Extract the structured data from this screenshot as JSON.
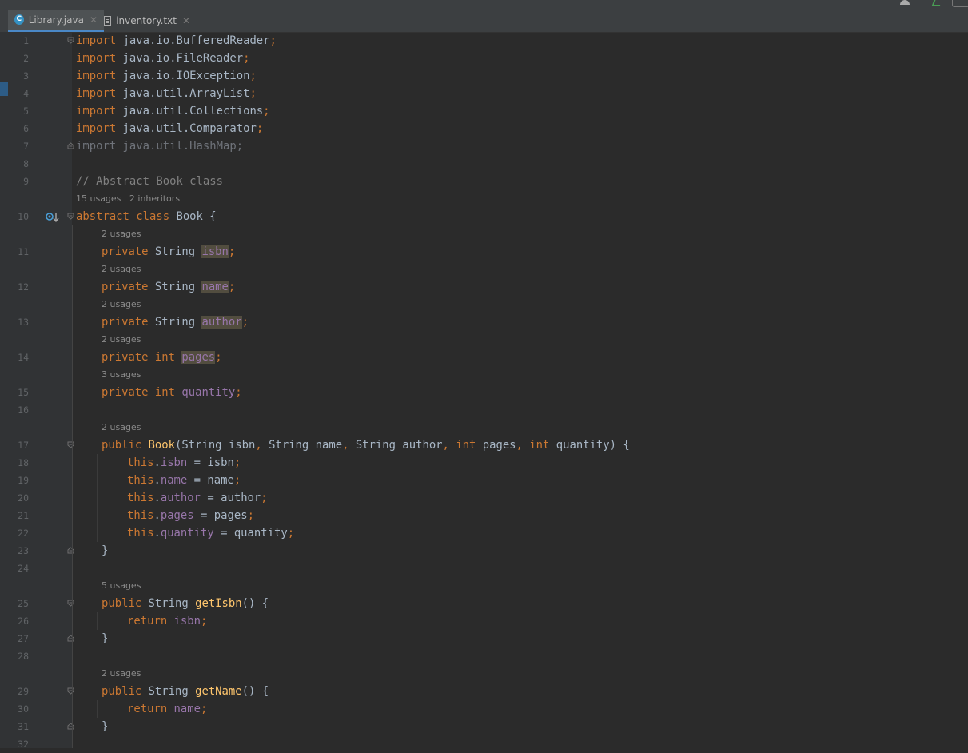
{
  "tabs": [
    {
      "label": "Library.java",
      "icon": "java-class-icon",
      "active": true
    },
    {
      "label": "inventory.txt",
      "icon": "text-file-icon",
      "active": false
    }
  ],
  "colors": {
    "keyword": "#cc7832",
    "field": "#9876aa",
    "method": "#ffc66d",
    "comment": "#808080",
    "text": "#a9b7c6",
    "background": "#2b2b2b",
    "gutter": "#313335",
    "tab_underline": "#4a88c7"
  },
  "code": {
    "lines": [
      {
        "n": "1",
        "tokens": [
          [
            "kw",
            "import"
          ],
          [
            "t",
            " java.io.BufferedReader"
          ],
          [
            "kw",
            ";"
          ]
        ],
        "fold": "open"
      },
      {
        "n": "2",
        "tokens": [
          [
            "kw",
            "import"
          ],
          [
            "t",
            " java.io.FileReader"
          ],
          [
            "kw",
            ";"
          ]
        ]
      },
      {
        "n": "3",
        "tokens": [
          [
            "kw",
            "import"
          ],
          [
            "t",
            " java.io.IOException"
          ],
          [
            "kw",
            ";"
          ]
        ]
      },
      {
        "n": "4",
        "tokens": [
          [
            "kw",
            "import"
          ],
          [
            "t",
            " java.util.ArrayList"
          ],
          [
            "kw",
            ";"
          ]
        ]
      },
      {
        "n": "5",
        "tokens": [
          [
            "kw",
            "import"
          ],
          [
            "t",
            " java.util.Collections"
          ],
          [
            "kw",
            ";"
          ]
        ]
      },
      {
        "n": "6",
        "tokens": [
          [
            "kw",
            "import"
          ],
          [
            "t",
            " java.util.Comparator"
          ],
          [
            "kw",
            ";"
          ]
        ]
      },
      {
        "n": "7",
        "tokens": [
          [
            "dim",
            "import java.util.HashMap;"
          ]
        ],
        "fold": "close"
      },
      {
        "n": "8",
        "tokens": []
      },
      {
        "n": "9",
        "tokens": [
          [
            "cmt",
            "// Abstract Book class"
          ]
        ]
      },
      {
        "hint": "15 usages   2 inheritors",
        "indent": 0
      },
      {
        "n": "10",
        "tokens": [
          [
            "kw",
            "abstract class "
          ],
          [
            "t",
            "Book {"
          ]
        ],
        "fold": "open",
        "marker": true
      },
      {
        "hint": "2 usages",
        "indent": 1
      },
      {
        "n": "11",
        "indent": 1,
        "tokens": [
          [
            "kw",
            "private "
          ],
          [
            "t",
            "String "
          ],
          [
            "fldhl",
            "isbn"
          ],
          [
            "kw",
            ";"
          ]
        ]
      },
      {
        "hint": "2 usages",
        "indent": 1
      },
      {
        "n": "12",
        "indent": 1,
        "tokens": [
          [
            "kw",
            "private "
          ],
          [
            "t",
            "String "
          ],
          [
            "fldhl",
            "name"
          ],
          [
            "kw",
            ";"
          ]
        ]
      },
      {
        "hint": "2 usages",
        "indent": 1
      },
      {
        "n": "13",
        "indent": 1,
        "tokens": [
          [
            "kw",
            "private "
          ],
          [
            "t",
            "String "
          ],
          [
            "fldhl",
            "author"
          ],
          [
            "kw",
            ";"
          ]
        ]
      },
      {
        "hint": "2 usages",
        "indent": 1
      },
      {
        "n": "14",
        "indent": 1,
        "tokens": [
          [
            "kw",
            "private int "
          ],
          [
            "fldhl",
            "pages"
          ],
          [
            "kw",
            ";"
          ]
        ]
      },
      {
        "hint": "3 usages",
        "indent": 1
      },
      {
        "n": "15",
        "indent": 1,
        "tokens": [
          [
            "kw",
            "private int "
          ],
          [
            "fld",
            "quantity"
          ],
          [
            "kw",
            ";"
          ]
        ]
      },
      {
        "n": "16",
        "tokens": []
      },
      {
        "hint": "2 usages",
        "indent": 1
      },
      {
        "n": "17",
        "indent": 1,
        "tokens": [
          [
            "kw",
            "public "
          ],
          [
            "fn",
            "Book"
          ],
          [
            "t",
            "(String isbn"
          ],
          [
            "kw",
            ", "
          ],
          [
            "t",
            "String name"
          ],
          [
            "kw",
            ", "
          ],
          [
            "t",
            "String author"
          ],
          [
            "kw",
            ", int "
          ],
          [
            "t",
            "pages"
          ],
          [
            "kw",
            ", int "
          ],
          [
            "t",
            "quantity) {"
          ]
        ],
        "fold": "open"
      },
      {
        "n": "18",
        "indent": 2,
        "tokens": [
          [
            "kw",
            "this"
          ],
          [
            "t",
            "."
          ],
          [
            "fld",
            "isbn"
          ],
          [
            "t",
            " = isbn"
          ],
          [
            "kw",
            ";"
          ]
        ]
      },
      {
        "n": "19",
        "indent": 2,
        "tokens": [
          [
            "kw",
            "this"
          ],
          [
            "t",
            "."
          ],
          [
            "fld",
            "name"
          ],
          [
            "t",
            " = name"
          ],
          [
            "kw",
            ";"
          ]
        ]
      },
      {
        "n": "20",
        "indent": 2,
        "tokens": [
          [
            "kw",
            "this"
          ],
          [
            "t",
            "."
          ],
          [
            "fld",
            "author"
          ],
          [
            "t",
            " = author"
          ],
          [
            "kw",
            ";"
          ]
        ]
      },
      {
        "n": "21",
        "indent": 2,
        "tokens": [
          [
            "kw",
            "this"
          ],
          [
            "t",
            "."
          ],
          [
            "fld",
            "pages"
          ],
          [
            "t",
            " = pages"
          ],
          [
            "kw",
            ";"
          ]
        ]
      },
      {
        "n": "22",
        "indent": 2,
        "tokens": [
          [
            "kw",
            "this"
          ],
          [
            "t",
            "."
          ],
          [
            "fld",
            "quantity"
          ],
          [
            "t",
            " = quantity"
          ],
          [
            "kw",
            ";"
          ]
        ]
      },
      {
        "n": "23",
        "indent": 1,
        "tokens": [
          [
            "t",
            "}"
          ]
        ],
        "fold": "close"
      },
      {
        "n": "24",
        "tokens": []
      },
      {
        "hint": "5 usages",
        "indent": 1
      },
      {
        "n": "25",
        "indent": 1,
        "tokens": [
          [
            "kw",
            "public "
          ],
          [
            "t",
            "String "
          ],
          [
            "fn",
            "getIsbn"
          ],
          [
            "t",
            "() {"
          ]
        ],
        "fold": "open"
      },
      {
        "n": "26",
        "indent": 2,
        "tokens": [
          [
            "kw",
            "return "
          ],
          [
            "fld",
            "isbn"
          ],
          [
            "kw",
            ";"
          ]
        ]
      },
      {
        "n": "27",
        "indent": 1,
        "tokens": [
          [
            "t",
            "}"
          ]
        ],
        "fold": "close"
      },
      {
        "n": "28",
        "tokens": []
      },
      {
        "hint": "2 usages",
        "indent": 1
      },
      {
        "n": "29",
        "indent": 1,
        "tokens": [
          [
            "kw",
            "public "
          ],
          [
            "t",
            "String "
          ],
          [
            "fn",
            "getName"
          ],
          [
            "t",
            "() {"
          ]
        ],
        "fold": "open"
      },
      {
        "n": "30",
        "indent": 2,
        "tokens": [
          [
            "kw",
            "return "
          ],
          [
            "fld",
            "name"
          ],
          [
            "kw",
            ";"
          ]
        ]
      },
      {
        "n": "31",
        "indent": 1,
        "tokens": [
          [
            "t",
            "}"
          ]
        ],
        "fold": "close"
      },
      {
        "n": "32",
        "tokens": []
      }
    ]
  }
}
